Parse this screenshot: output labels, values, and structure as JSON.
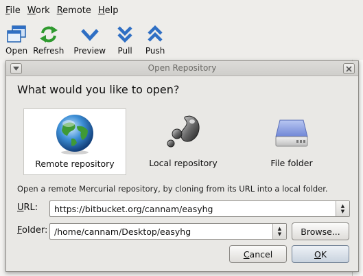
{
  "menubar": {
    "items": [
      {
        "label": "File",
        "mnemonic": "F",
        "rest": "ile"
      },
      {
        "label": "Work",
        "mnemonic": "W",
        "rest": "ork"
      },
      {
        "label": "Remote",
        "mnemonic": "R",
        "rest": "emote"
      },
      {
        "label": "Help",
        "mnemonic": "H",
        "rest": "elp"
      }
    ]
  },
  "toolbar": {
    "open": "Open",
    "refresh": "Refresh",
    "preview": "Preview",
    "pull": "Pull",
    "push": "Push"
  },
  "dialog": {
    "title": "Open Repository",
    "question": "What would you like to open?",
    "choices": {
      "remote": "Remote repository",
      "local": "Local repository",
      "folder": "File folder"
    },
    "selected_choice": "Remote repository",
    "description": "Open a remote Mercurial repository, by cloning from its URL into a local folder.",
    "url_label_mnemonic": "U",
    "url_label_rest": "RL:",
    "url_value": "https://bitbucket.org/cannam/easyhg",
    "folder_label_mnemonic": "F",
    "folder_label_rest": "older:",
    "folder_value": "/home/cannam/Desktop/easyhg",
    "browse_label": "Browse...",
    "cancel_mnemonic": "C",
    "cancel_rest": "ancel",
    "ok_mnemonic": "O",
    "ok_rest": "K"
  },
  "colors": {
    "toolbar_blue": "#2f6fc4",
    "refresh_green": "#2f9a2f"
  }
}
